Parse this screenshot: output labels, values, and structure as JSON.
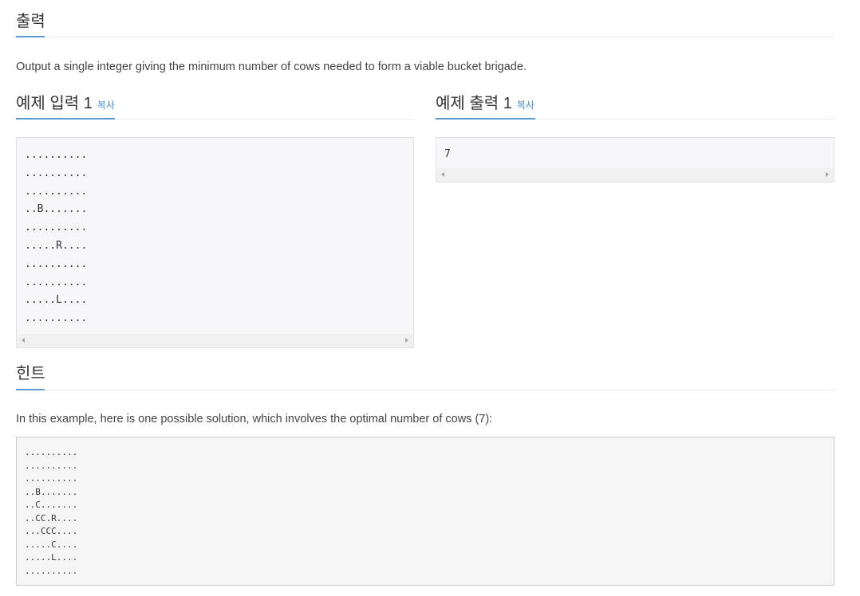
{
  "output_section": {
    "title": "출력",
    "description": "Output a single integer giving the minimum number of cows needed to form a viable bucket brigade."
  },
  "sample_input": {
    "title": "예제 입력 1",
    "copy_label": "복사",
    "lines": [
      "..........",
      "..........",
      "..........",
      "..B.......",
      "..........",
      ".....R....",
      "..........",
      "..........",
      ".....L....",
      ".........."
    ]
  },
  "sample_output": {
    "title": "예제 출력 1",
    "copy_label": "복사",
    "lines": [
      "7"
    ]
  },
  "hint_section": {
    "title": "힌트",
    "description": "In this example, here is one possible solution, which involves the optimal number of cows (7):",
    "lines": [
      "..........",
      "..........",
      "..........",
      "..B.......",
      "..C.......",
      "..CC.R....",
      "...CCC....",
      ".....C....",
      ".....L....",
      ".........."
    ]
  },
  "colors": {
    "accent": "#5b9bd1",
    "link": "#428bca",
    "pre_background": "#f7f7f9"
  }
}
